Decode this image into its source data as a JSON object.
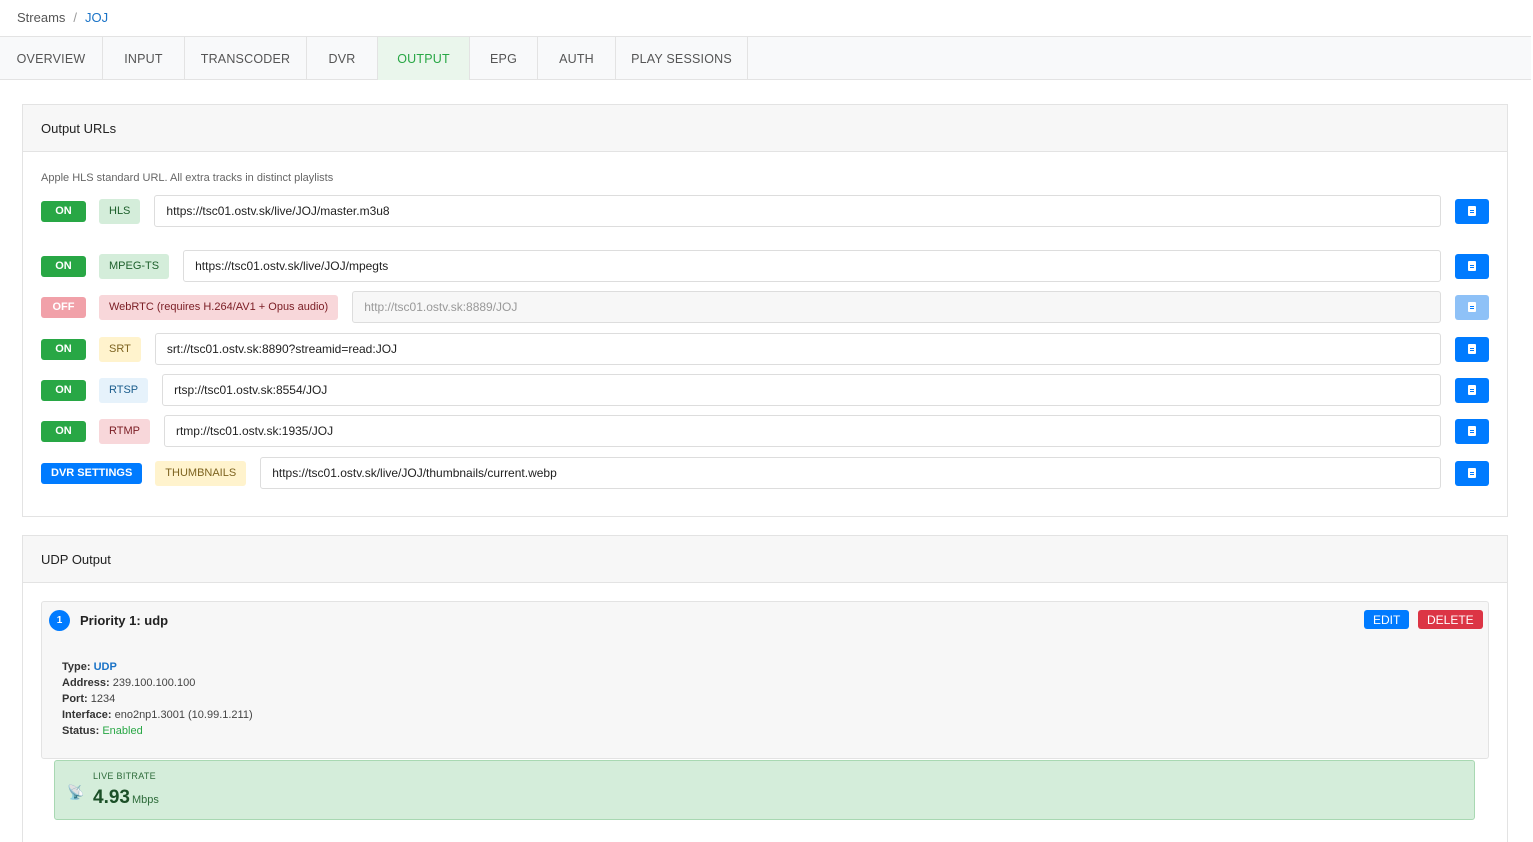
{
  "breadcrumb": {
    "root": "Streams",
    "separator": "/",
    "current": "JOJ"
  },
  "tabs": [
    "OVERVIEW",
    "INPUT",
    "TRANSCODER",
    "DVR",
    "OUTPUT",
    "EPG",
    "AUTH",
    "PLAY SESSIONS"
  ],
  "active_tab": "OUTPUT",
  "output_urls": {
    "title": "Output URLs",
    "hint": "Apple HLS standard URL. All extra tracks in distinct playlists",
    "rows": [
      {
        "state": "ON",
        "protocol": "HLS",
        "url": "https://tsc01.ostv.sk/live/JOJ/master.m3u8"
      },
      {
        "state": "ON",
        "protocol": "MPEG-TS",
        "url": "https://tsc01.ostv.sk/live/JOJ/mpegts"
      },
      {
        "state": "OFF",
        "protocol": "WebRTC (requires H.264/AV1 + Opus audio)",
        "url": "http://tsc01.ostv.sk:8889/JOJ"
      },
      {
        "state": "ON",
        "protocol": "SRT",
        "url": "srt://tsc01.ostv.sk:8890?streamid=read:JOJ"
      },
      {
        "state": "ON",
        "protocol": "RTSP",
        "url": "rtsp://tsc01.ostv.sk:8554/JOJ"
      },
      {
        "state": "ON",
        "protocol": "RTMP",
        "url": "rtmp://tsc01.ostv.sk:1935/JOJ"
      },
      {
        "state": "DVR SETTINGS",
        "protocol": "THUMBNAILS",
        "url": "https://tsc01.ostv.sk/live/JOJ/thumbnails/current.webp"
      }
    ],
    "copy_icon": "document-icon"
  },
  "udp_output": {
    "title": "UDP Output",
    "priority_number": "1",
    "priority_title": "Priority 1: udp",
    "edit_label": "EDIT",
    "delete_label": "DELETE",
    "type_label": "Type:",
    "type_value": "UDP",
    "address_label": "Address:",
    "address_value": "239.100.100.100",
    "port_label": "Port:",
    "port_value": "1234",
    "interface_label": "Interface:",
    "interface_value": "eno2np1.3001 (10.99.1.211)",
    "status_label": "Status:",
    "status_value": "Enabled",
    "live_bitrate_label": "LIVE BITRATE",
    "live_bitrate_value": "4.93",
    "live_bitrate_unit": "Mbps"
  },
  "colors": {
    "accent": "#007bff",
    "success": "#28a745",
    "danger": "#dc3545"
  }
}
